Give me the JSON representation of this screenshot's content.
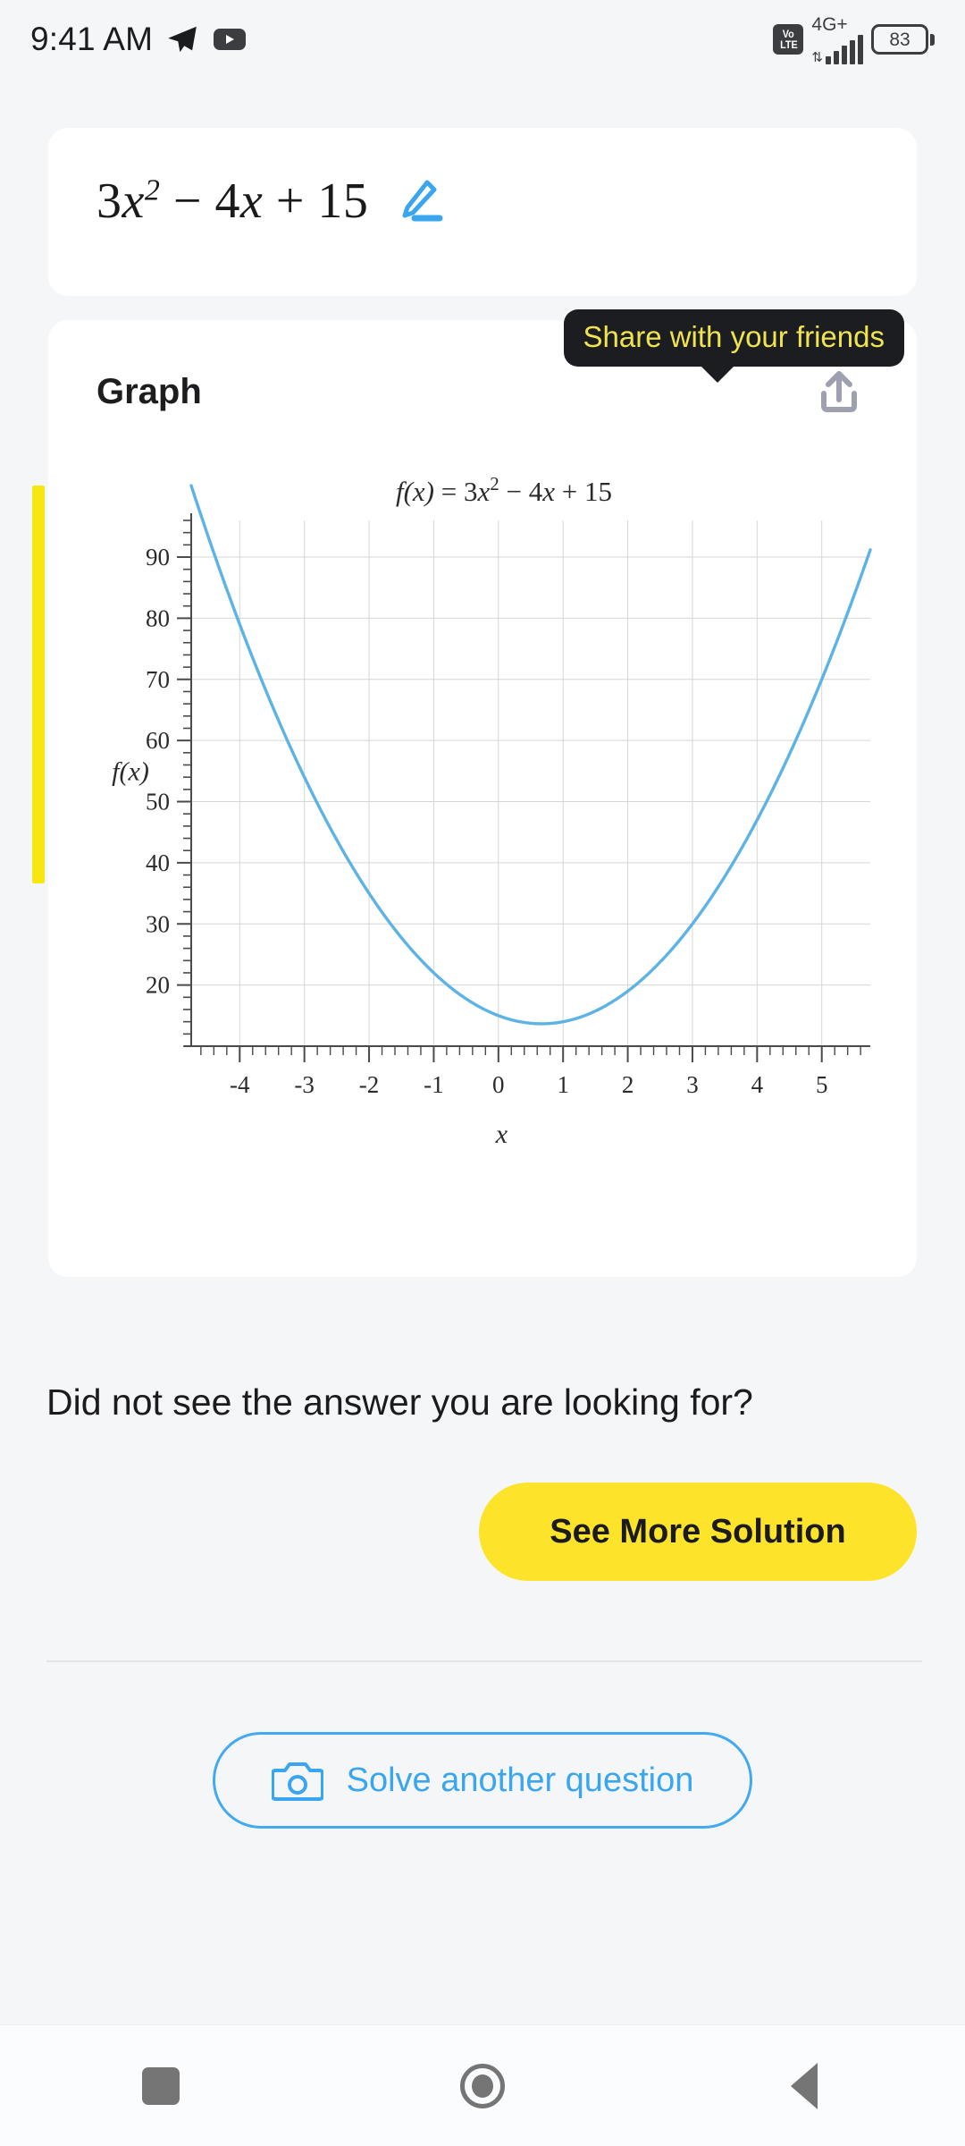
{
  "status_bar": {
    "time": "9:41 AM",
    "telegram_icon": "telegram-icon",
    "youtube_icon": "youtube-icon",
    "volte_top": "Vo",
    "volte_bottom": "LTE",
    "network": "4G+",
    "battery_level": "83"
  },
  "equation_card": {
    "coefficient_a": "3",
    "var": "x",
    "exponent": "2",
    "minus": "−",
    "coefficient_b": "4",
    "plus": "+",
    "constant": "15",
    "full_text": "3x² − 4x + 15",
    "edit_icon": "pencil-edit-icon"
  },
  "graph_card": {
    "title": "Graph",
    "share_icon": "share-upload-icon",
    "tooltip": "Share with your friends",
    "accent_color": "#f7e60f"
  },
  "bottom": {
    "prompt": "Did not see the answer you are looking for?",
    "see_more_label": "See More Solution",
    "solve_label": "Solve another question",
    "camera_icon": "camera-icon"
  },
  "nav_bar": {
    "recents": "recents-square-icon",
    "home": "home-circle-icon",
    "back": "back-triangle-icon"
  },
  "colors": {
    "accent_yellow": "#fde42a",
    "accent_blue": "#3aa6ef",
    "curve_blue": "#5cb3e4",
    "tooltip_bg": "#1c1d21",
    "tooltip_text": "#efe44e"
  },
  "chart_data": {
    "type": "line",
    "title": "f(x) = 3x² − 4x + 15",
    "title_parts": {
      "fx": "f(x)",
      "eq": "=",
      "a": "3x",
      "sup": "2",
      "minus": "−",
      "b": "4x",
      "plus": "+",
      "c": "15"
    },
    "xlabel": "x",
    "ylabel": "f(x)",
    "expression": "3*x^2 - 4*x + 15",
    "xlim": [
      -4.75,
      5.75
    ],
    "ylim": [
      10,
      96
    ],
    "xticks": [
      -4,
      -3,
      -2,
      -1,
      0,
      1,
      2,
      3,
      4,
      5
    ],
    "yticks": [
      20,
      30,
      40,
      50,
      60,
      70,
      80,
      90
    ],
    "xtick_labels": [
      "-4",
      "-3",
      "-2",
      "-1",
      "0",
      "1",
      "2",
      "3",
      "4",
      "5"
    ],
    "ytick_labels": [
      "20",
      "30",
      "40",
      "50",
      "60",
      "70",
      "80",
      "90"
    ],
    "minor_tick_step_x": 0.2,
    "minor_tick_step_y": 2,
    "grid": true,
    "legend": null,
    "vertex": {
      "x": 0.667,
      "y": 13.67
    },
    "series": [
      {
        "name": "f(x) = 3x² − 4x + 15",
        "color": "#5cb3e4",
        "x": [
          -4.75,
          -4.5,
          -4,
          -3.5,
          -3,
          -2.5,
          -2,
          -1.5,
          -1,
          -0.5,
          0,
          0.5,
          0.667,
          1,
          1.5,
          2,
          2.5,
          3,
          3.5,
          4,
          4.5,
          5,
          5.35
        ],
        "y": [
          101.7,
          95.75,
          79,
          65.75,
          54,
          43.75,
          35,
          27.75,
          22,
          17.75,
          15,
          13.75,
          13.67,
          14,
          15.75,
          19,
          23.75,
          30,
          37.75,
          47,
          57.75,
          70,
          79.5
        ]
      }
    ]
  }
}
